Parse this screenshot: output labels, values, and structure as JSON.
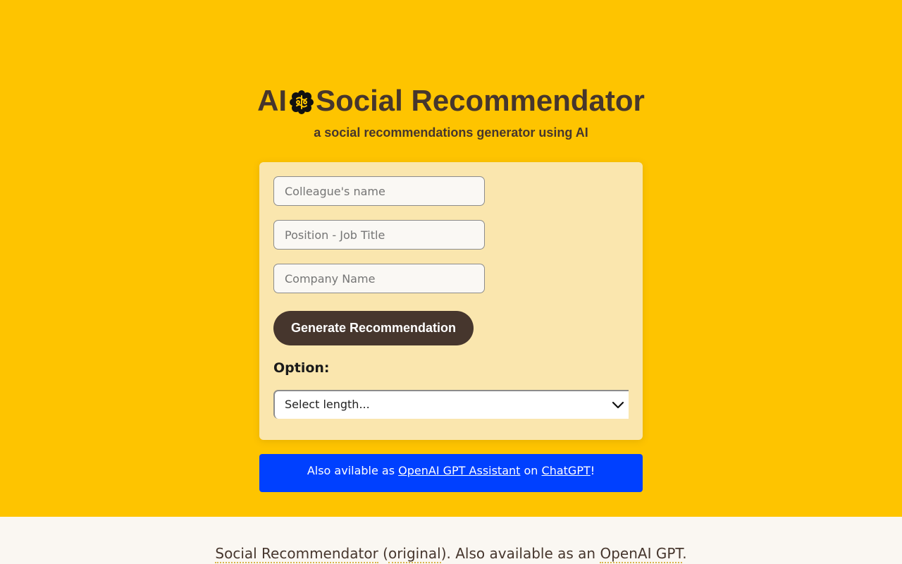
{
  "header": {
    "title_part1": "AI",
    "title_part2": "Social Recommendator",
    "subtitle": "a social recommendations generator using AI",
    "brain_icon": "brain-icon"
  },
  "form": {
    "name_placeholder": "Colleague's name",
    "position_placeholder": "Position - Job Title",
    "company_placeholder": "Company Name",
    "generate_label": "Generate Recommendation",
    "option_label": "Option:",
    "length_select": "Select length..."
  },
  "banner": {
    "prefix": "Also avilable as ",
    "link1": "OpenAI GPT Assistant",
    "middle": " on ",
    "link2": "ChatGPT",
    "suffix": "!"
  },
  "footer": {
    "link1": "Social Recommendator",
    "sep1": " (",
    "link2": "original",
    "sep2": "). Also available as an ",
    "link3": "OpenAI GPT",
    "end": "."
  },
  "colors": {
    "hero_bg": "#fec400",
    "card_bg": "#fae6ae",
    "button_bg": "#46362d",
    "banner_bg": "#0040ff"
  }
}
